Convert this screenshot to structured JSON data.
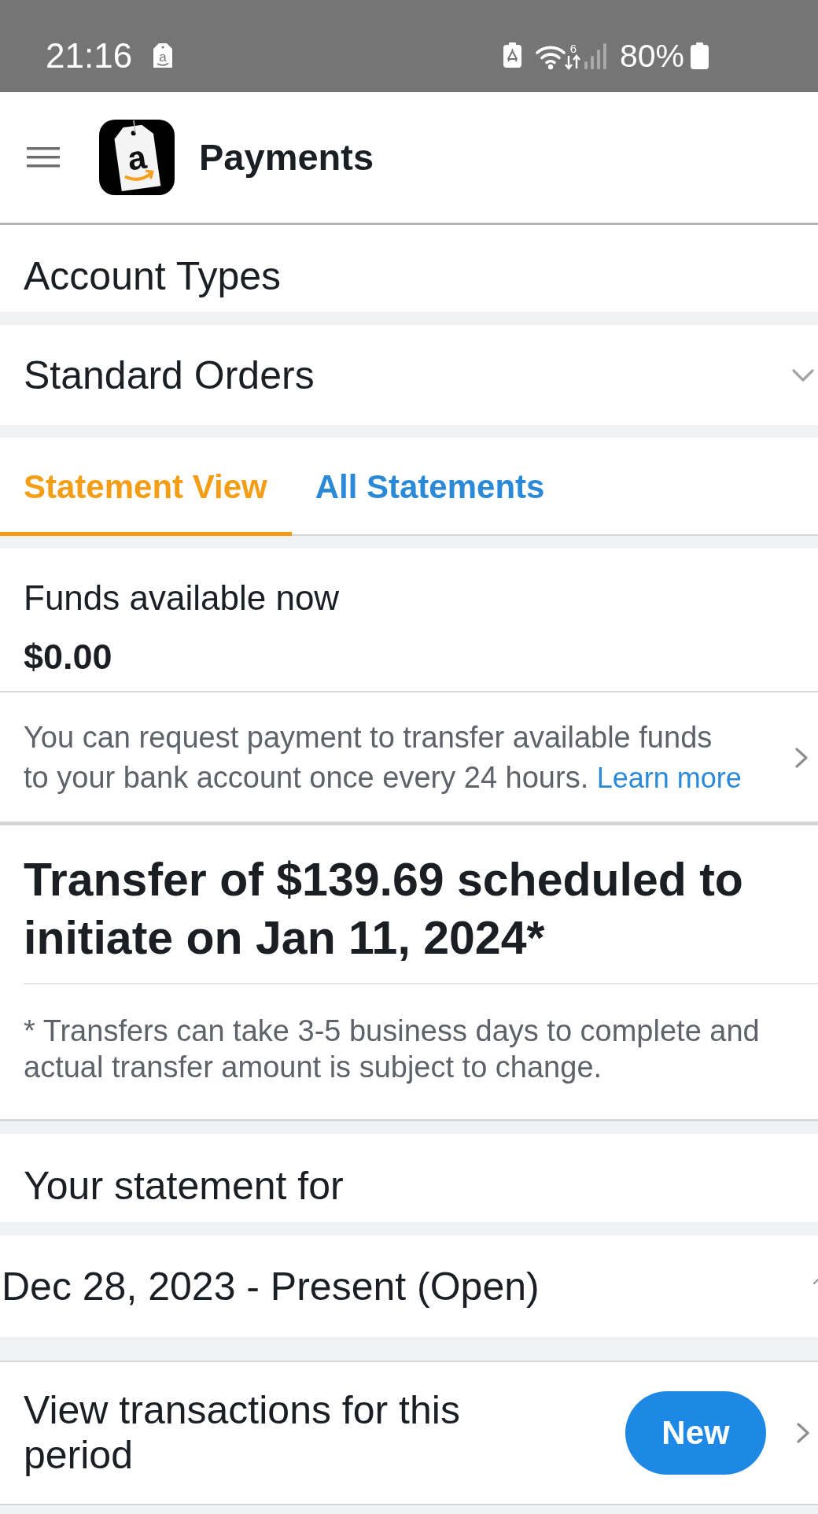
{
  "status_bar": {
    "time": "21:16",
    "notification_letter": "a",
    "wifi_badge": "6",
    "battery": "80%"
  },
  "header": {
    "title": "Payments",
    "logo_letter": "a"
  },
  "account_types": {
    "label": "Account Types"
  },
  "account_selector": {
    "value": "Standard Orders"
  },
  "tabs": [
    {
      "label": "Statement View",
      "selected": true
    },
    {
      "label": "All Statements",
      "selected": false
    }
  ],
  "funds": {
    "label": "Funds available now",
    "amount": "$0.00"
  },
  "payment_info": {
    "text": "You can request payment to transfer available funds to your bank account once every 24 hours.",
    "link": "Learn more"
  },
  "transfer": {
    "title": "Transfer of $139.69 scheduled to initiate on Jan 11, 2024*",
    "footnote": "* Transfers can take 3-5 business days to complete and actual transfer amount is subject to change."
  },
  "statement": {
    "label": "Your statement for",
    "period": "Dec 28, 2023 - Present (Open)"
  },
  "transactions_row": {
    "label": "View transactions for this period",
    "badge": "New"
  }
}
